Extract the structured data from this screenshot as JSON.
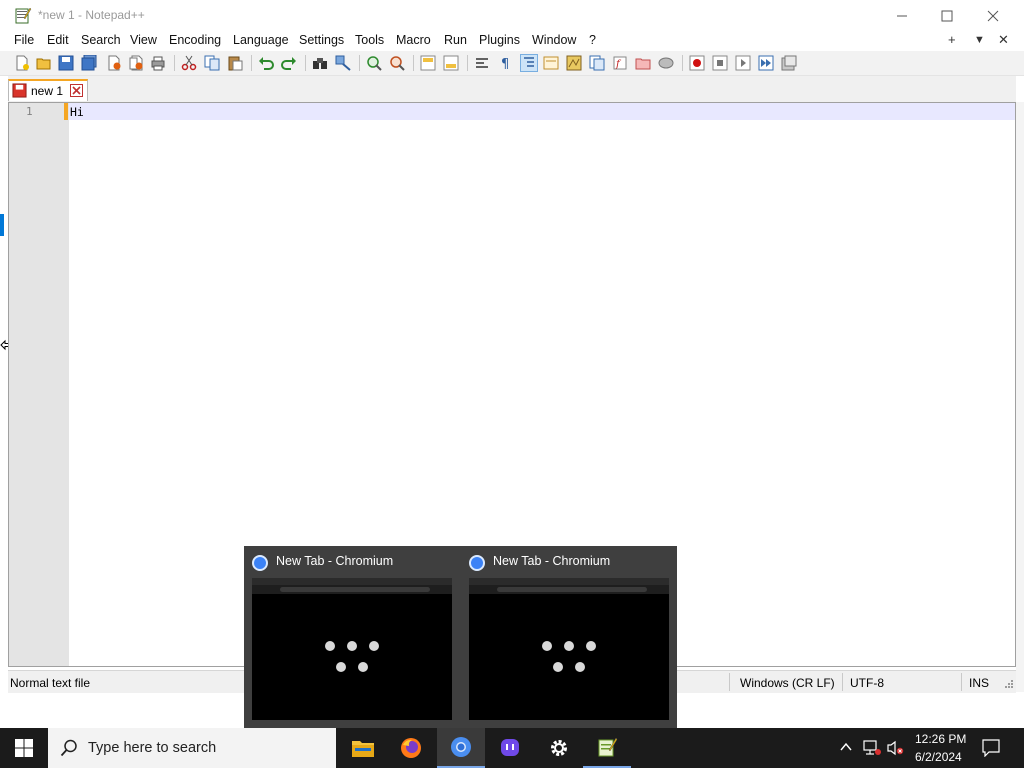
{
  "window": {
    "title": "*new 1 - Notepad++",
    "controls": [
      "minimize",
      "maximize",
      "close"
    ]
  },
  "menu": {
    "items": [
      "File",
      "Edit",
      "Search",
      "View",
      "Encoding",
      "Language",
      "Settings",
      "Tools",
      "Macro",
      "Run",
      "Plugins",
      "Window",
      "?"
    ],
    "right_controls": [
      "+",
      "▼",
      "✕"
    ]
  },
  "toolbar": {
    "buttons": [
      "new-icon",
      "open-icon",
      "save-icon",
      "save-all-icon",
      "close-icon",
      "close-all-icon",
      "print-icon",
      "cut-icon",
      "copy-icon",
      "paste-icon",
      "undo-icon",
      "redo-icon",
      "find-icon",
      "replace-icon",
      "zoom-in-icon",
      "zoom-out-icon",
      "sync-v-icon",
      "sync-h-icon",
      "word-wrap-icon",
      "show-all-chars-icon",
      "indent-guide-icon",
      "udl-icon",
      "doc-map-icon",
      "doc-list-icon",
      "function-list-icon",
      "folder-workspace-icon",
      "monitoring-icon",
      "record-macro-icon",
      "stop-record-icon",
      "play-macro-icon",
      "run-macro-multiple-icon",
      "save-macro-icon"
    ]
  },
  "tab": {
    "label": "new 1"
  },
  "editor": {
    "line_number": "1",
    "line_text": "Hi"
  },
  "status": {
    "file_type": "Normal text file",
    "eol": "Windows (CR LF)",
    "encoding": "UTF-8",
    "mode": "INS"
  },
  "task_preview": {
    "windows": [
      {
        "title": "New Tab - Chromium"
      },
      {
        "title": "New Tab - Chromium"
      }
    ]
  },
  "taskbar": {
    "search_placeholder": "Type here to search",
    "apps": [
      "file-explorer-icon",
      "firefox-icon",
      "chromium-icon",
      "mastodon-icon",
      "settings-icon",
      "notepadpp-icon"
    ],
    "time": "12:26 PM",
    "date": "6/2/2024"
  },
  "colors": {
    "accent": "#f5a623",
    "current_line": "#e8e8ff",
    "taskbar": "#1b1b1b",
    "preview_bg": "#3f3f3f"
  }
}
